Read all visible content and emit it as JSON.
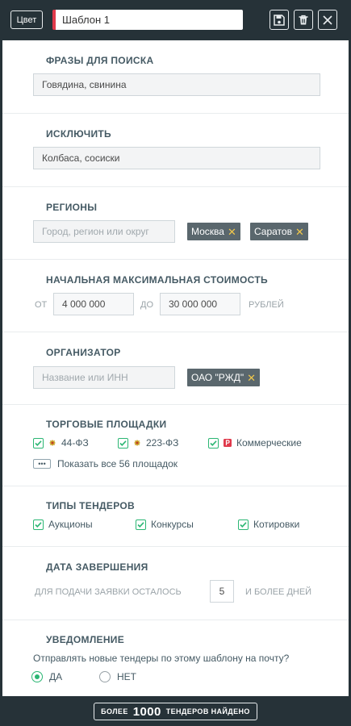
{
  "header": {
    "color_label": "Цвет",
    "template_name": "Шаблон 1"
  },
  "search": {
    "title": "Фразы для поиска",
    "value": "Говядина, свинина"
  },
  "exclude": {
    "title": "Исключить",
    "value": "Колбаса, сосиски"
  },
  "regions": {
    "title": "Регионы",
    "placeholder": "Город, регион или округ",
    "tags": [
      "Москва",
      "Саратов"
    ]
  },
  "price": {
    "title": "Начальная максимальная стоимость",
    "from_label": "от",
    "from_value": "4 000 000",
    "to_label": "до",
    "to_value": "30 000 000",
    "unit": "рублей"
  },
  "organizer": {
    "title": "Организатор",
    "placeholder": "Название или ИНН",
    "tags": [
      "ОАО \"РЖД\""
    ]
  },
  "platforms": {
    "title": "Торговые площадки",
    "items": [
      "44-ФЗ",
      "223-ФЗ",
      "Коммерческие"
    ],
    "show_all": "Показать все 56 площадок"
  },
  "types": {
    "title": "Типы тендеров",
    "items": [
      "Аукционы",
      "Конкурсы",
      "Котировки"
    ]
  },
  "deadline": {
    "title": "Дата завершения",
    "prefix": "для подачи заявки осталось",
    "days": "5",
    "suffix": "и более дней"
  },
  "notify": {
    "title": "Уведомление",
    "question": "Отправлять новые тендеры по этому шаблону на почту?",
    "yes": "Да",
    "no": "Нет"
  },
  "footer": {
    "prefix": "БОЛЕЕ",
    "count": "1000",
    "suffix": "ТЕНДЕРОВ НАЙДЕНО"
  },
  "colors": {
    "dark": "#263238",
    "accent_red": "#e0394b",
    "check_green": "#2bb673",
    "tag_bg": "#5a676d",
    "tag_x": "#f1c84b"
  }
}
